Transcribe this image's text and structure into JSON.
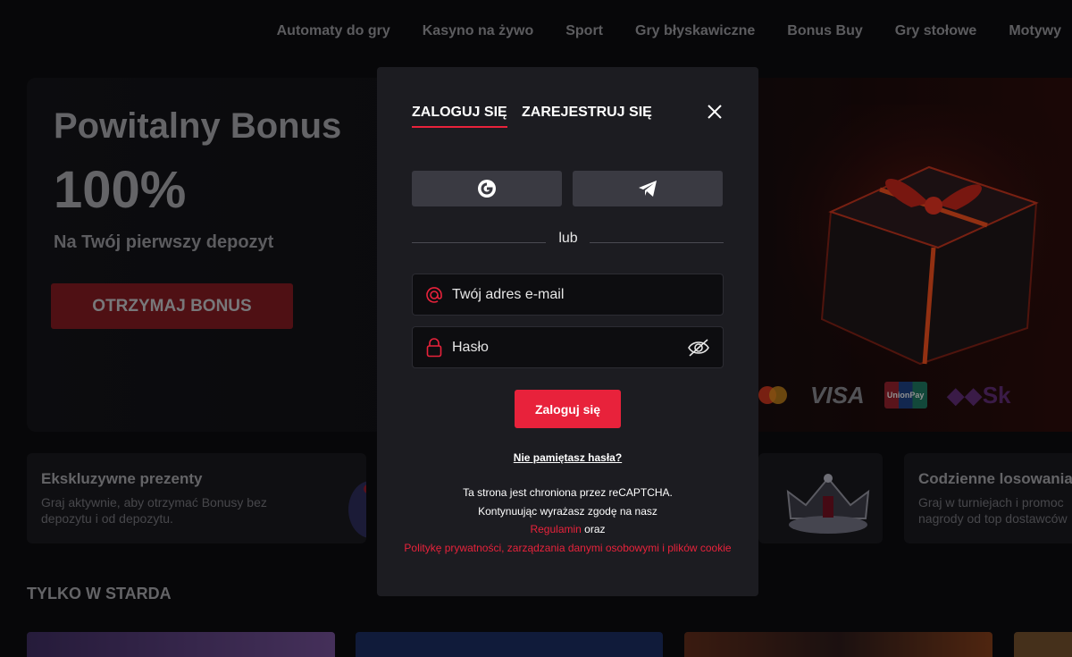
{
  "nav": {
    "items": [
      "Automaty do gry",
      "Kasyno na żywo",
      "Sport",
      "Gry błyskawiczne",
      "Bonus Buy",
      "Gry stołowe",
      "Motywy"
    ]
  },
  "hero": {
    "title": "Powitalny Bonus",
    "amount": "100%",
    "subtitle": "Na Twój pierwszy depozyt",
    "cta": "OTRZYMAJ BONUS",
    "payments": {
      "visa": "VISA",
      "unionpay": "UnionPay",
      "skrill": "Sk"
    }
  },
  "cards": [
    {
      "title": "Ekskluzywne prezenty",
      "desc": "Graj aktywnie, aby otrzymać Bonusy bez depozytu i od depozytu."
    },
    {
      "title": "Codzienne losowania n",
      "desc": "Graj w turniejach i promoc nagrody od top dostawców"
    }
  ],
  "section": {
    "title": "TYLKO W STARDA"
  },
  "modal": {
    "tab_login": "ZALOGUJ SIĘ",
    "tab_register": "ZAREJESTRUJ SIĘ",
    "divider": "lub",
    "email_placeholder": "Twój adres e-mail",
    "password_placeholder": "Hasło",
    "login_button": "Zaloguj się",
    "forgot": "Nie pamiętasz hasła?",
    "legal_line1": "Ta strona jest chroniona przez reCAPTCHA.",
    "legal_line2": "Kontynuując wyrażasz zgodę na nasz",
    "legal_terms": "Regulamin",
    "legal_and": " oraz",
    "legal_privacy": "Politykę prywatności, zarządzania danymi osobowymi i plików cookie"
  },
  "colors": {
    "accent": "#e8223b",
    "modal_bg": "#1c1c21",
    "page_bg": "#0b0b0e"
  },
  "icons": [
    "google-icon",
    "telegram-icon",
    "at-icon",
    "lock-icon",
    "eye-slash-icon",
    "close-icon"
  ]
}
